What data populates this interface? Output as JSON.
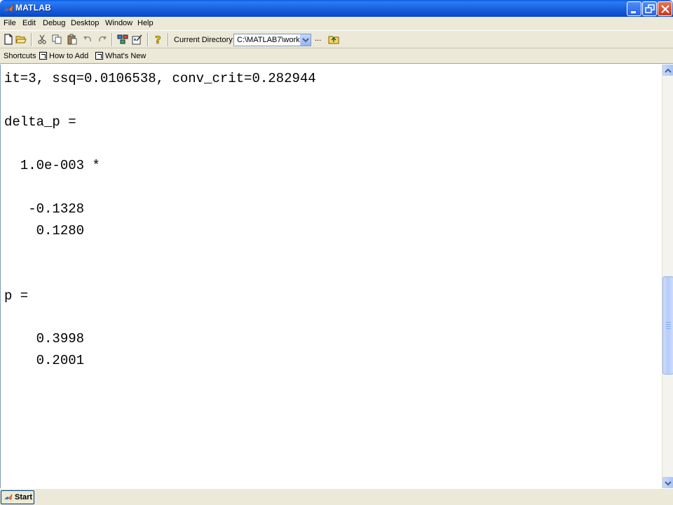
{
  "window": {
    "title": "MATLAB",
    "controls": {
      "minimize": "minimize",
      "maximize": "maximize",
      "close": "close"
    }
  },
  "menu": {
    "items": [
      "File",
      "Edit",
      "Debug",
      "Desktop",
      "Window",
      "Help"
    ]
  },
  "toolbar": {
    "icons": [
      "new-file-icon",
      "open-folder-icon",
      "cut-icon",
      "copy-icon",
      "paste-icon",
      "undo-icon",
      "redo-icon",
      "simulink-icon",
      "guide-icon",
      "help-icon"
    ],
    "current_directory_label": "Current Directory:",
    "current_directory_value": "C:\\MATLAB7\\work",
    "browse_label": "...",
    "up_folder_icon": "up-folder-icon"
  },
  "shortcuts": {
    "label": "Shortcuts",
    "items": [
      "How to Add",
      "What's New"
    ]
  },
  "command_window": {
    "lines": [
      "it=3, ssq=0.0106538, conv_crit=0.282944",
      "delta_p =",
      "  1.0e-003 *",
      "   -0.1328",
      "    0.1280",
      "p =",
      "    0.3998",
      "    0.2001"
    ]
  },
  "taskbar": {
    "start_label": "Start"
  }
}
